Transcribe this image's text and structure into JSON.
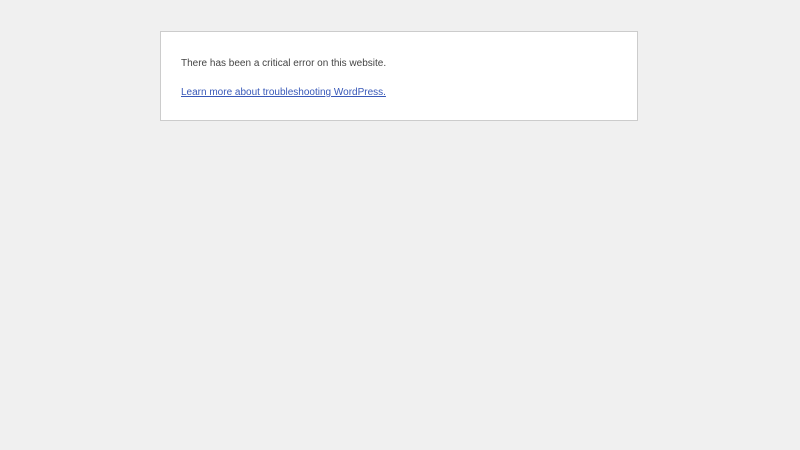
{
  "error": {
    "message": "There has been a critical error on this website.",
    "link_label": "Learn more about troubleshooting WordPress."
  },
  "colors": {
    "page_background": "#f0f0f0",
    "box_background": "#ffffff",
    "box_border": "#cccccc",
    "text": "#444444",
    "link": "#3858b8"
  }
}
